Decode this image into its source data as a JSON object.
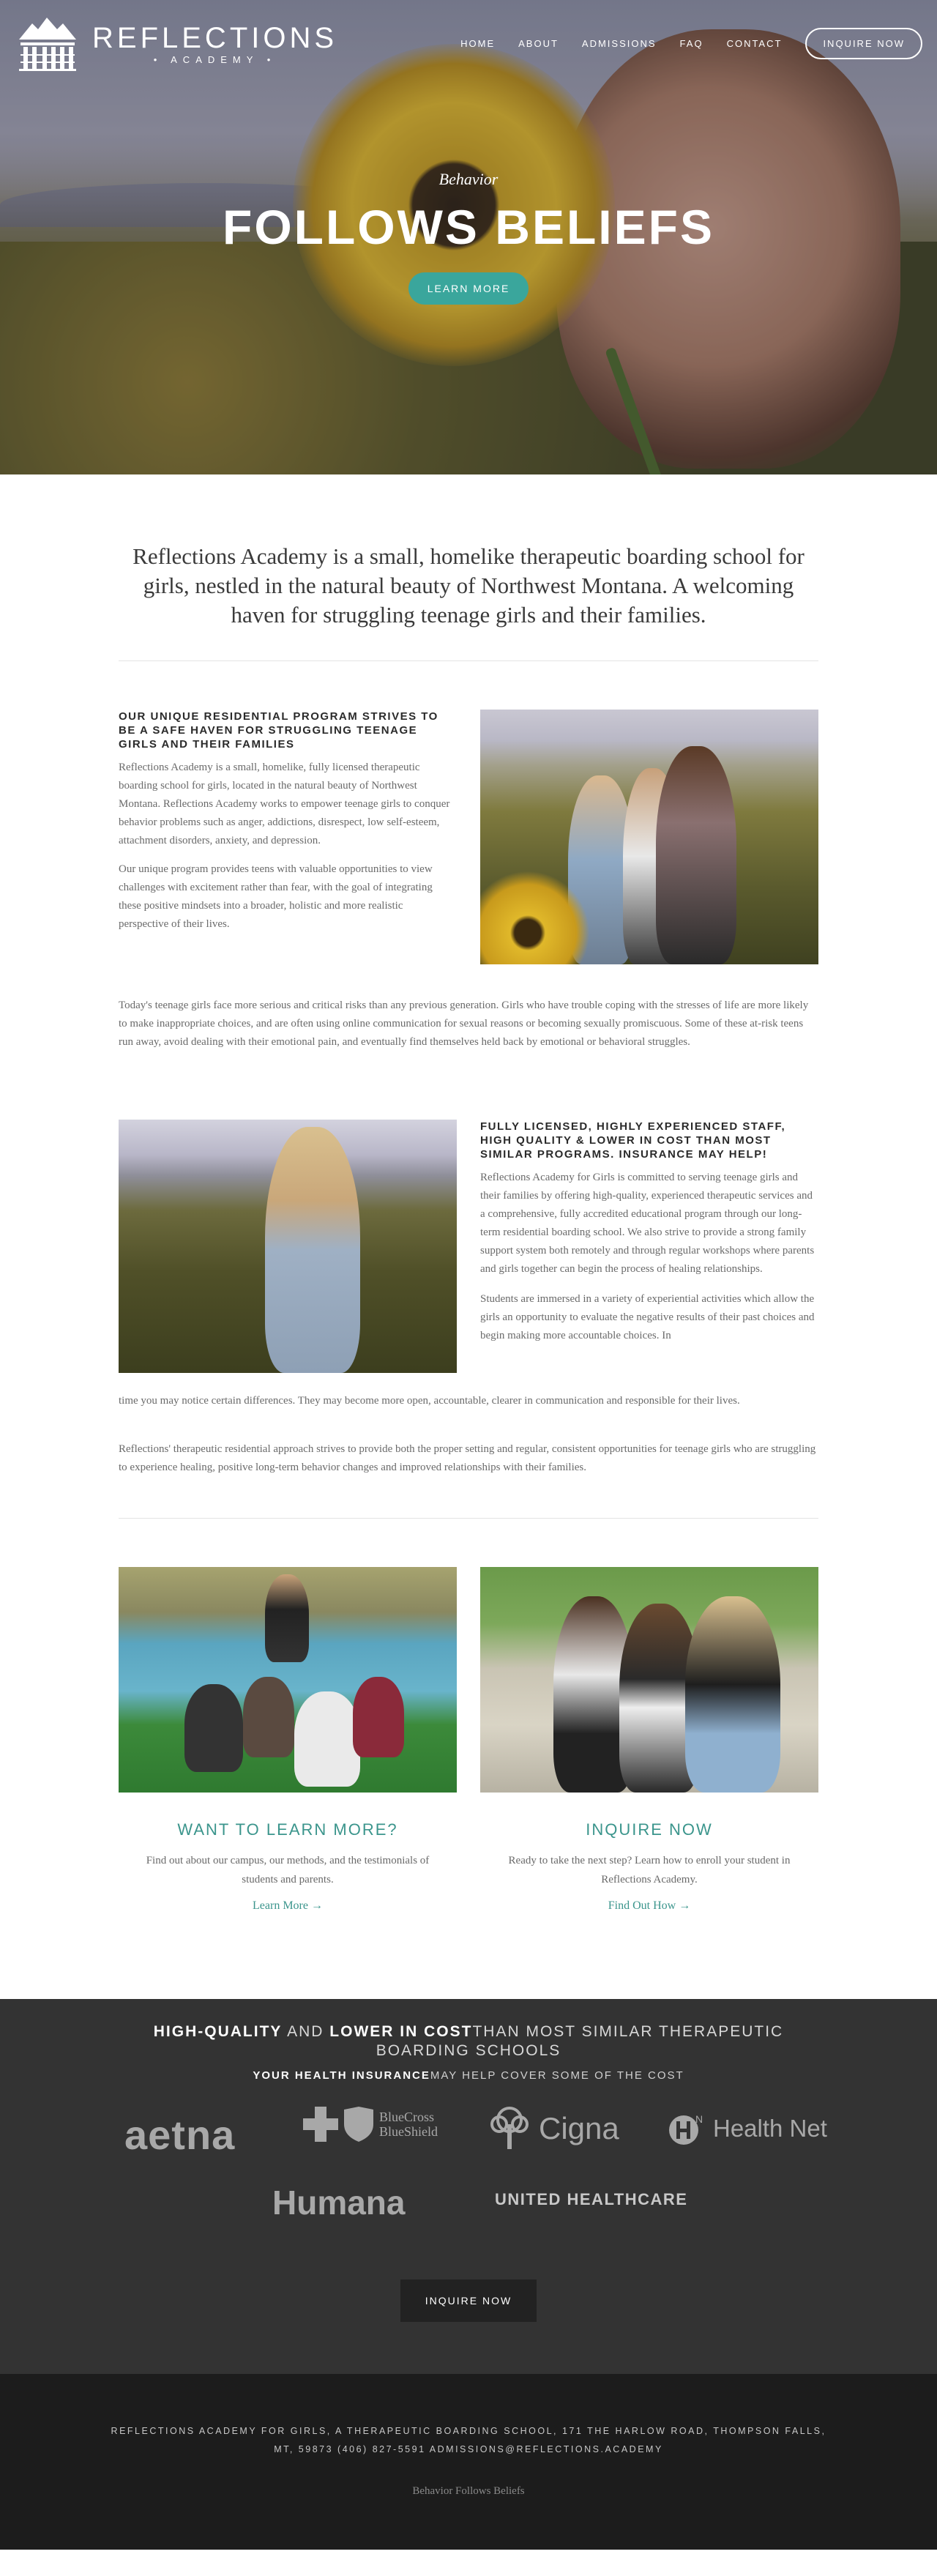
{
  "brand": {
    "name": "REFLECTIONS",
    "sub": "• ACADEMY •"
  },
  "nav": {
    "items": [
      {
        "label": "HOME"
      },
      {
        "label": "ABOUT"
      },
      {
        "label": "ADMISSIONS"
      },
      {
        "label": "FAQ"
      },
      {
        "label": "CONTACT"
      }
    ],
    "cta": "INQUIRE NOW"
  },
  "hero": {
    "subtitle": "Behavior",
    "title": "FOLLOWS BELIEFS",
    "button": "LEARN MORE"
  },
  "intro": "Reflections Academy is a small, homelike therapeutic boarding school for girls, nestled in the natural beauty of Northwest Montana. A welcoming haven for struggling teenage girls and their families.",
  "section1": {
    "heading": "OUR UNIQUE RESIDENTIAL PROGRAM STRIVES TO BE A SAFE HAVEN FOR STRUGGLING TEENAGE GIRLS AND THEIR FAMILIES",
    "p1": "Reflections Academy is a small, homelike, fully licensed therapeutic boarding school for girls, located in the natural beauty of Northwest Montana. Reflections Academy works to empower teenage girls to conquer behavior problems such as anger, addictions, disrespect, low self-esteem, attachment disorders, anxiety, and depression.",
    "p2": "Our unique program provides teens with valuable opportunities to view challenges with excitement rather than fear, with the goal of integrating these positive mindsets into a broader, holistic and more realistic perspective of their lives.",
    "p3": "Today's teenage girls face more serious and critical risks than any previous generation. Girls who have trouble coping with the stresses of life are more likely to make inappropriate choices, and are often using online communication for sexual reasons or becoming sexually promiscuous. Some of these at-risk teens run away, avoid dealing with their emotional pain, and eventually find themselves held back by emotional or behavioral struggles."
  },
  "section2": {
    "heading": "FULLY LICENSED, HIGHLY EXPERIENCED STAFF, HIGH QUALITY & LOWER IN COST THAN MOST SIMILAR PROGRAMS. INSURANCE MAY HELP!",
    "p1": "Reflections Academy for Girls is committed to serving teenage girls and their families by offering high-quality, experienced therapeutic services and a comprehensive, fully accredited educational program through our long-term residential boarding school. We also strive to provide a strong family support system both remotely and through regular workshops where parents and girls together can begin the process of healing relationships.",
    "p2a": "Students are immersed in a variety of experiential activities which allow the girls an opportunity to evaluate the negative results of their past choices and begin making more accountable choices. In",
    "p2b": "time you may notice certain differences. They may become more open, accountable, clearer in communication and responsible for their lives.",
    "p3": "Reflections' therapeutic residential approach strives to provide both the proper setting and regular, consistent opportunities for teenage girls who are struggling to experience healing, positive long-term behavior changes and improved relationships with their families."
  },
  "cards": [
    {
      "title": "WANT TO LEARN MORE?",
      "text": "Find out about our campus, our methods, and the testimonials of students and parents.",
      "link": "Learn More →"
    },
    {
      "title": "INQUIRE NOW",
      "text": "Ready to take the next step? Learn how to enroll your student in Reflections Academy.",
      "link": "Find Out How →"
    }
  ],
  "insurance": {
    "h_b1": "HIGH-QUALITY",
    "h_t1": " AND ",
    "h_b2": "LOWER IN COST",
    "h_t2": "THAN MOST SIMILAR THERAPEUTIC",
    "h_t3": "BOARDING SCHOOLS",
    "sub_b": "YOUR HEALTH INSURANCE",
    "sub_t": "MAY HELP COVER SOME OF THE COST",
    "logos": {
      "aetna": "aetna",
      "bcbs1": "BlueCross",
      "bcbs2": "BlueShield",
      "cigna": "Cigna",
      "healthnet": "Health Net",
      "humana": "Humana",
      "uhc": "UNITED HEALTHCARE"
    },
    "button": "INQUIRE NOW"
  },
  "footer": {
    "address": "REFLECTIONS ACADEMY FOR GIRLS, A THERAPEUTIC BOARDING SCHOOL, 171 THE HARLOW ROAD, THOMPSON FALLS, MT, 59873  (406) 827-5591  ADMISSIONS@REFLECTIONS.ACADEMY",
    "tagline": "Behavior Follows Beliefs"
  },
  "colors": {
    "accent": "#3aa69c",
    "dark_band": "#333333",
    "footer": "#1c1c1c"
  }
}
